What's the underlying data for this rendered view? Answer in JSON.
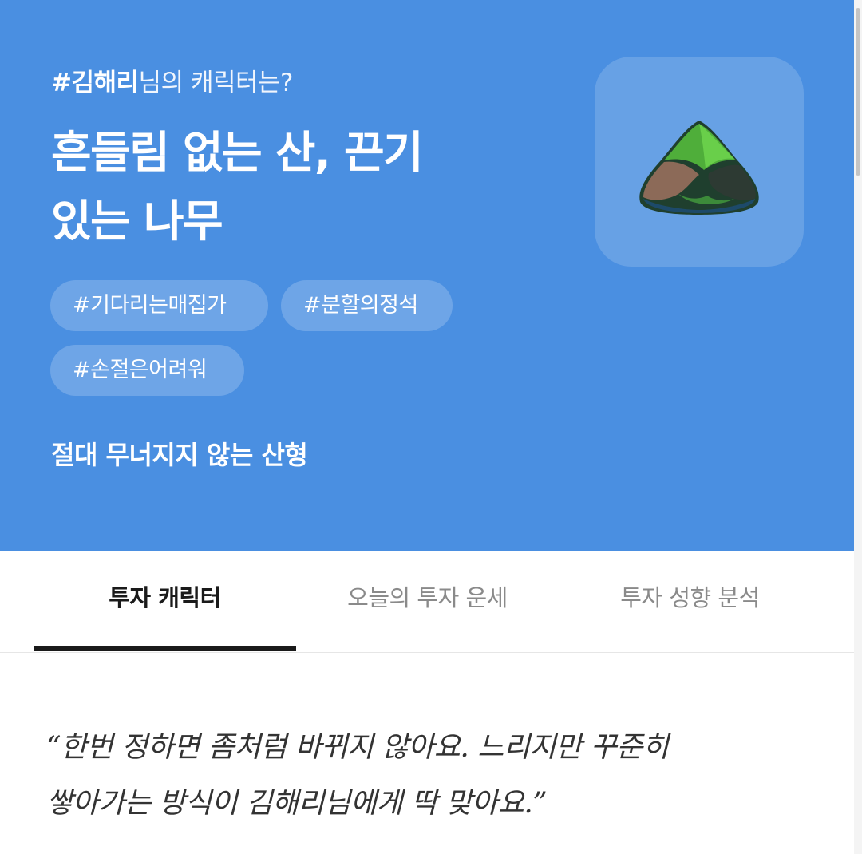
{
  "hero": {
    "eyebrow_name": "#김해리",
    "eyebrow_suffix": "님의 캐릭터는?",
    "headline_line1": "흔들림 없는 산, 끈기",
    "headline_line2": "있는 나무",
    "character_icon": "mountain-icon",
    "tags": [
      "#기다리는매집가",
      "#분할의정석",
      "#손절은어려워"
    ],
    "description": "절대 무너지지 않는 산형",
    "background_color": "#4a8fe1"
  },
  "tabs": [
    {
      "label": "투자 캐릭터",
      "active": true
    },
    {
      "label": "오늘의 투자 운세",
      "active": false
    },
    {
      "label": "투자 성향 분석",
      "active": false
    }
  ],
  "quote": {
    "line1": "“한번 정하면 좀처럼 바뀌지 않아요. 느리지만 꾸준히",
    "line2": "쌓아가는 방식이 김해리님에게 딱 맞아요.”"
  }
}
